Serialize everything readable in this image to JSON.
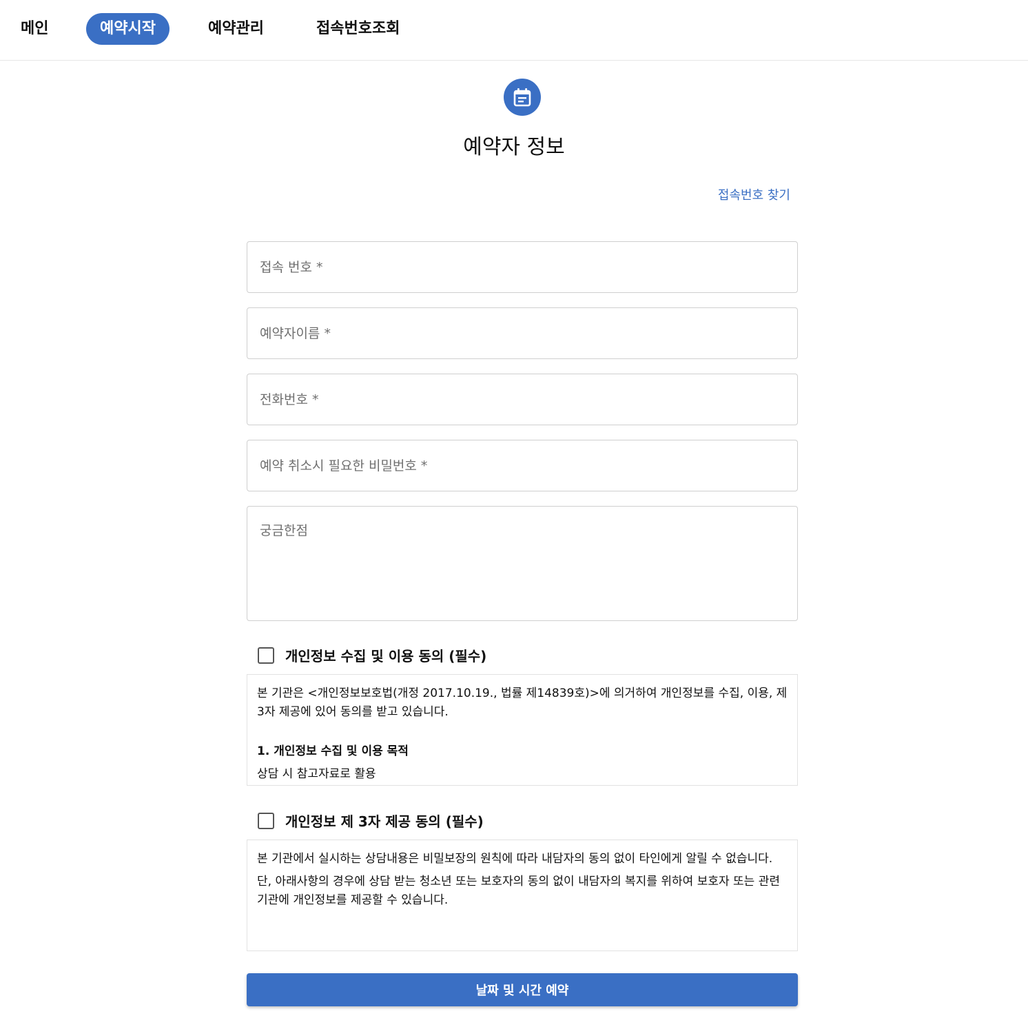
{
  "nav": {
    "items": [
      {
        "label": "메인"
      },
      {
        "label": "예약시작",
        "active": true
      },
      {
        "label": "예약관리"
      },
      {
        "label": "접속번호조회"
      }
    ]
  },
  "header": {
    "icon": "calendar-icon",
    "title": "예약자 정보"
  },
  "find_link": "접속번호 찾기",
  "form": {
    "access_number_placeholder": "접속 번호 *",
    "name_placeholder": "예약자이름 *",
    "phone_placeholder": "전화번호 *",
    "password_placeholder": "예약 취소시 필요한 비밀번호 *",
    "question_placeholder": "궁금한점"
  },
  "consent1": {
    "label": "개인정보 수집 및 이용 동의 (필수)",
    "checked": false,
    "text1": "본 기관은 <개인정보보호법(개정 2017.10.19., 법률 제14839호)>에 의거하여 개인정보를 수집, 이용, 제 3자 제공에 있어 동의를 받고 있습니다.",
    "section_title": "1. 개인정보 수집 및 이용 목적",
    "section_text": "상담 시 참고자료로 활용"
  },
  "consent2": {
    "label": "개인정보 제 3자 제공 동의 (필수)",
    "checked": false,
    "text1": "본 기관에서 실시하는 상담내용은 비밀보장의 원칙에 따라 내담자의 동의 없이 타인에게 알릴 수 없습니다.",
    "text2": "단, 아래사항의 경우에 상담 받는 청소년 또는 보호자의 동의 없이 내담자의 복지를 위하여 보호자 또는 관련 기관에 개인정보를 제공할 수 있습니다."
  },
  "submit_label": "날짜 및 시간 예약",
  "colors": {
    "accent": "#3a6fc4"
  }
}
